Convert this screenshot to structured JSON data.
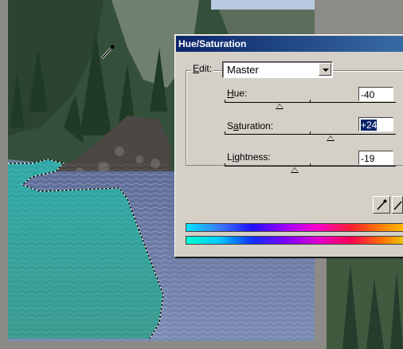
{
  "dialog": {
    "title": "Hue/Saturation",
    "edit_label": "Edit:",
    "edit_value": "Master",
    "hue": {
      "label": "Hue:",
      "value": "-40",
      "slider_fraction": 0.32
    },
    "saturation": {
      "label": "Saturation:",
      "value": "+24",
      "slider_fraction": 0.62
    },
    "lightness": {
      "label": "Lightness:",
      "value": "-19",
      "slider_fraction": 0.41
    }
  },
  "colors": {
    "selection_fill": "#3fa9a2",
    "water": "#5f6e9a",
    "forest": "#2f4a35",
    "dialog_bg": "#d4d0c8",
    "titlebar": "#0a246a"
  },
  "icons": [
    "eyedropper-icon",
    "eyedropper-plus-icon",
    "dropdown-arrow-icon"
  ]
}
